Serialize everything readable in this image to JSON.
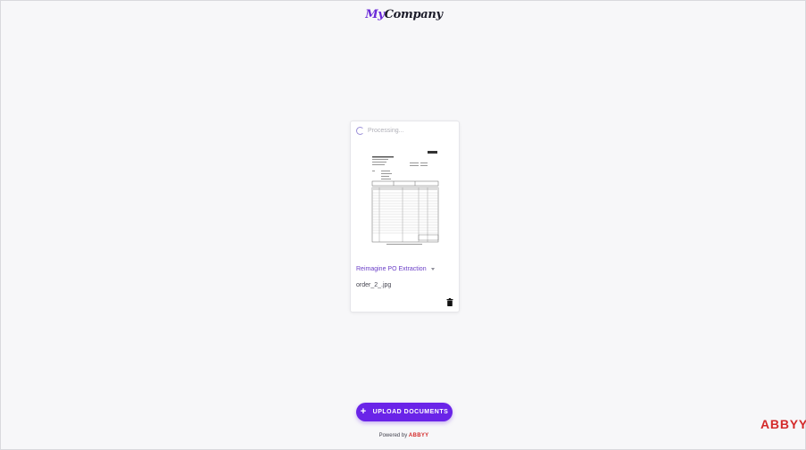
{
  "header": {
    "logo_part1": "My",
    "logo_part2": "Company"
  },
  "card": {
    "status": "Processing...",
    "doc_type": "Reimagine PO Extraction",
    "filename": "order_2_.jpg"
  },
  "upload": {
    "label": "UPLOAD DOCUMENTS"
  },
  "footer": {
    "powered_by": "Powered by",
    "brand": "ABBYY"
  },
  "watermark": "ABBYY",
  "colors": {
    "accent": "#6a24e8",
    "brand_red": "#d42a2a"
  }
}
